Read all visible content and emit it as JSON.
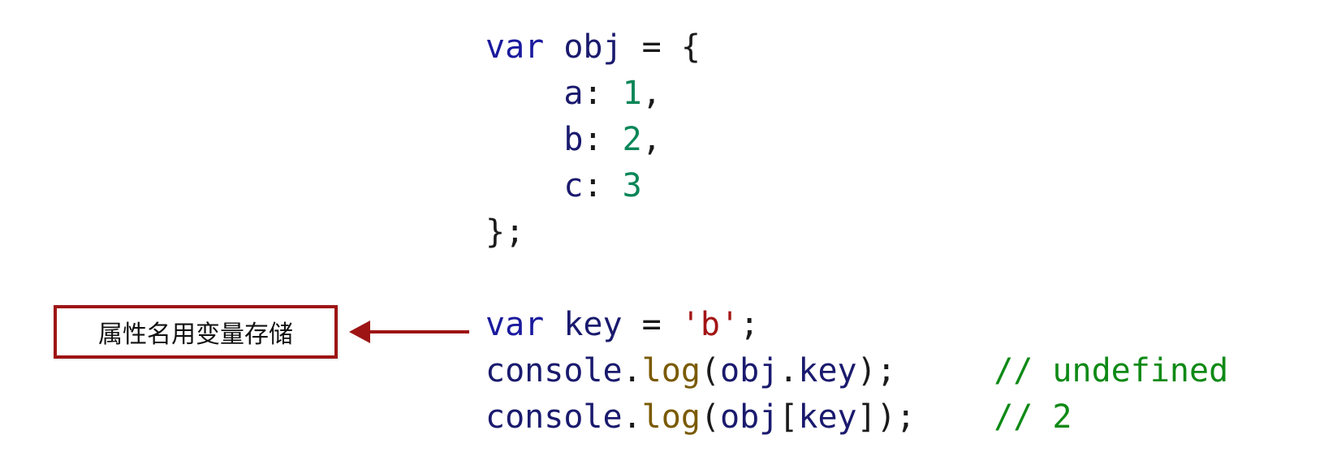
{
  "code_lines": [
    [
      [
        "kw",
        "var"
      ],
      [
        "punc",
        " "
      ],
      [
        "id",
        "obj"
      ],
      [
        "punc",
        " = {"
      ]
    ],
    [
      [
        "punc",
        "    "
      ],
      [
        "id",
        "a"
      ],
      [
        "punc",
        ": "
      ],
      [
        "num",
        "1"
      ],
      [
        "punc",
        ","
      ]
    ],
    [
      [
        "punc",
        "    "
      ],
      [
        "id",
        "b"
      ],
      [
        "punc",
        ": "
      ],
      [
        "num",
        "2"
      ],
      [
        "punc",
        ","
      ]
    ],
    [
      [
        "punc",
        "    "
      ],
      [
        "id",
        "c"
      ],
      [
        "punc",
        ": "
      ],
      [
        "num",
        "3"
      ]
    ],
    [
      [
        "punc",
        "};"
      ]
    ],
    [],
    [
      [
        "kw",
        "var"
      ],
      [
        "punc",
        " "
      ],
      [
        "id",
        "key"
      ],
      [
        "punc",
        " = "
      ],
      [
        "str",
        "'b'"
      ],
      [
        "punc",
        ";"
      ]
    ],
    [
      [
        "id",
        "console"
      ],
      [
        "punc",
        "."
      ],
      [
        "fn",
        "log"
      ],
      [
        "punc",
        "("
      ],
      [
        "id",
        "obj"
      ],
      [
        "punc",
        "."
      ],
      [
        "id",
        "key"
      ],
      [
        "punc",
        ");     "
      ],
      [
        "cm",
        "// undefined"
      ]
    ],
    [
      [
        "id",
        "console"
      ],
      [
        "punc",
        "."
      ],
      [
        "fn",
        "log"
      ],
      [
        "punc",
        "("
      ],
      [
        "id",
        "obj"
      ],
      [
        "punc",
        "["
      ],
      [
        "id",
        "key"
      ],
      [
        "punc",
        "]);    "
      ],
      [
        "cm",
        "// 2"
      ]
    ]
  ],
  "annotation": {
    "label": "属性名用变量存储",
    "border_color": "#9e1414",
    "arrow_color": "#9e1414"
  }
}
